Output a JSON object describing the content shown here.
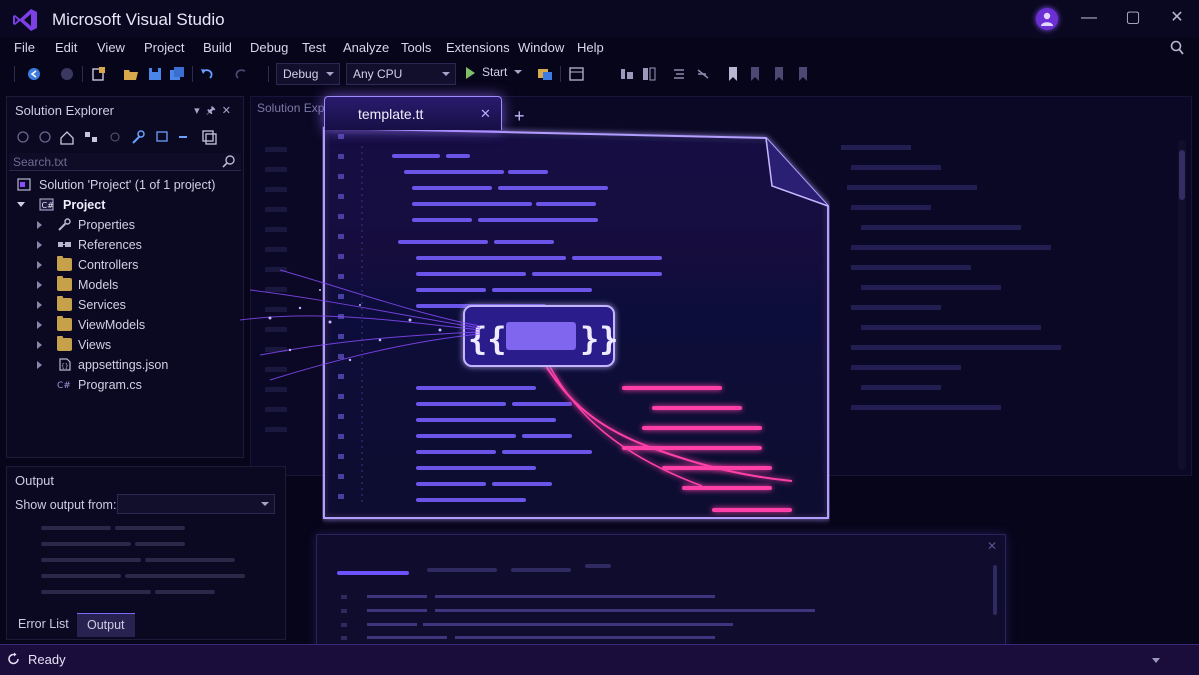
{
  "app": {
    "title": "Microsoft Visual Studio",
    "accent": "#8a4dff"
  },
  "menu": [
    "File",
    "Edit",
    "View",
    "Project",
    "Build",
    "Debug",
    "Test",
    "Analyze",
    "Tools",
    "Extensions",
    "Window",
    "Help"
  ],
  "toolbar": {
    "config": "Debug",
    "platform": "Any CPU",
    "start_label": "Start"
  },
  "solution_explorer": {
    "title": "Solution Explorer",
    "search_placeholder": "Search.txt",
    "solution_label": "Solution 'Project' (1 of 1 project)",
    "project_label": "Project",
    "items": [
      {
        "label": "Properties",
        "icon": "wrench-icon"
      },
      {
        "label": "References",
        "icon": "references-icon"
      },
      {
        "label": "Controllers",
        "icon": "folder-icon"
      },
      {
        "label": "Models",
        "icon": "folder-icon"
      },
      {
        "label": "Services",
        "icon": "folder-icon"
      },
      {
        "label": "ViewModels",
        "icon": "folder-icon"
      },
      {
        "label": "Views",
        "icon": "folder-icon"
      },
      {
        "label": "appsettings.json",
        "icon": "json-file-icon"
      },
      {
        "label": "Program.cs",
        "icon": "csharp-file-icon"
      }
    ]
  },
  "output": {
    "title": "Output",
    "show_from_label": "Show output from:"
  },
  "bottom_tabs": [
    "Error List",
    "Output"
  ],
  "editor": {
    "tab_label": "template.tt",
    "bg_tab_label": "Solution Expl"
  },
  "status": {
    "text": "Ready"
  }
}
